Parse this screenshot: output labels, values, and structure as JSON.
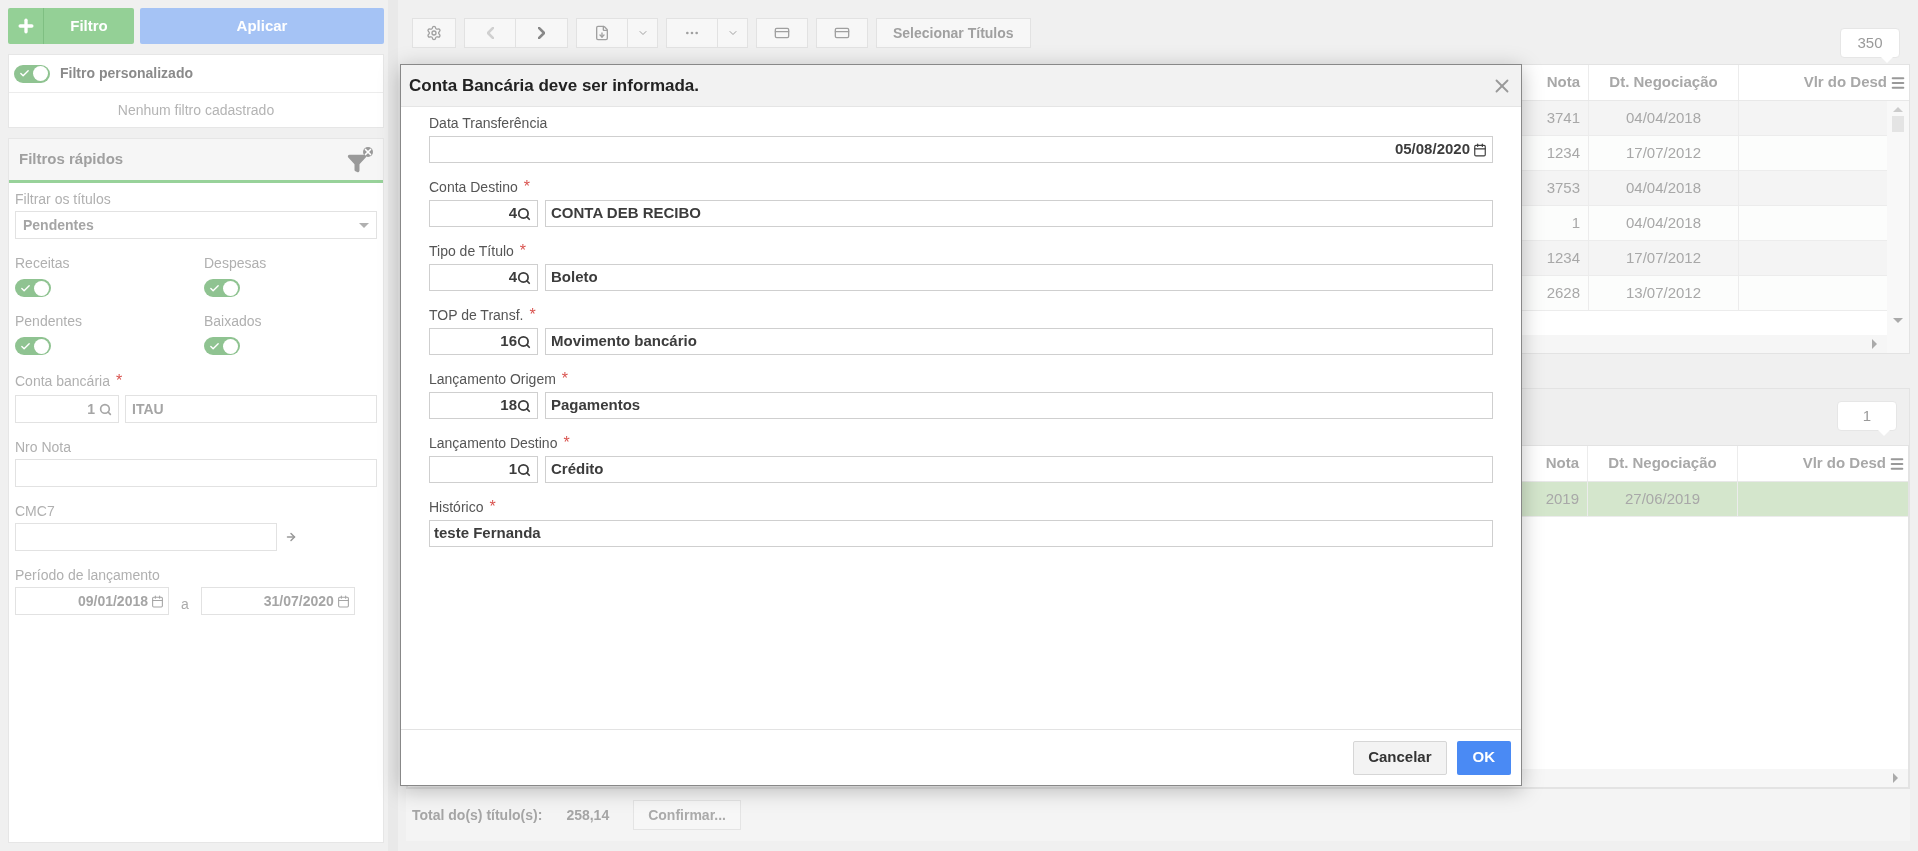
{
  "filter_bar": {
    "add_button": "Filtro",
    "apply_button": "Aplicar"
  },
  "custom_filter": {
    "label": "Filtro personalizado",
    "on": true,
    "empty_message": "Nenhum filtro cadastrado"
  },
  "quick_filters": {
    "title": "Filtros rápidos",
    "items": [
      {
        "kind": "select",
        "label": "Filtrar os títulos",
        "value": "Pendentes"
      },
      {
        "kind": "toggles",
        "toggles": [
          {
            "label": "Receitas",
            "on": true
          },
          {
            "label": "Despesas",
            "on": true
          }
        ]
      },
      {
        "kind": "toggles",
        "toggles": [
          {
            "label": "Pendentes",
            "on": true
          },
          {
            "label": "Baixados",
            "on": true
          }
        ]
      },
      {
        "kind": "lookup",
        "label": "Conta bancária",
        "required_mark": "*",
        "code": "1",
        "name": "ITAU"
      },
      {
        "kind": "text",
        "label": "Nro Nota"
      },
      {
        "kind": "text_action",
        "label": "CMC7"
      },
      {
        "kind": "date_range",
        "label": "Período de lançamento",
        "from": "09/01/2018",
        "separator": "a",
        "to": "31/07/2020"
      }
    ]
  },
  "toolbar": {
    "select_button": "Selecionar Títulos"
  },
  "grids": [
    {
      "count": "350",
      "columns": [
        "Nota",
        "Dt. Negociação",
        "Vlr do Desd"
      ],
      "rows": [
        {
          "cells": [
            "3741",
            "04/04/2018"
          ],
          "selected": false
        },
        {
          "cells": [
            "1234",
            "17/07/2012"
          ],
          "selected": false
        },
        {
          "cells": [
            "3753",
            "04/04/2018"
          ],
          "selected": false
        },
        {
          "cells": [
            "1",
            "04/04/2018"
          ],
          "selected": false
        },
        {
          "cells": [
            "1234",
            "17/07/2012"
          ],
          "selected": false
        },
        {
          "cells": [
            "2628",
            "13/07/2012"
          ],
          "selected": false
        }
      ]
    },
    {
      "count": "1",
      "columns": [
        "Nota",
        "Dt. Negociação",
        "Vlr do Desd"
      ],
      "rows": [
        {
          "cells": [
            "2019",
            "27/06/2019"
          ],
          "selected": true
        }
      ]
    }
  ],
  "footer": {
    "total_label": "Total do(s) título(s):",
    "total_value": "258,14",
    "confirm_button": "Confirmar..."
  },
  "dialog": {
    "title": "Conta Bancária deve ser informada.",
    "fields": [
      {
        "kind": "date",
        "label": "Data Transferência",
        "value": "05/08/2020"
      },
      {
        "kind": "lookup",
        "label": "Conta Destino",
        "required_mark": "*",
        "code": "4",
        "name": "CONTA DEB RECIBO"
      },
      {
        "kind": "lookup",
        "label": "Tipo de Título",
        "required_mark": "*",
        "code": "4",
        "name": "Boleto"
      },
      {
        "kind": "lookup",
        "label": "TOP de Transf.",
        "required_mark": "*",
        "code": "16",
        "name": "Movimento bancário"
      },
      {
        "kind": "lookup",
        "label": "Lançamento Origem",
        "required_mark": "*",
        "code": "18",
        "name": "Pagamentos"
      },
      {
        "kind": "lookup",
        "label": "Lançamento Destino",
        "required_mark": "*",
        "code": "1",
        "name": "Crédito"
      },
      {
        "kind": "text",
        "label": "Histórico",
        "required_mark": "*",
        "value": "teste Fernanda"
      }
    ],
    "buttons": [
      {
        "label": "Cancelar",
        "kind": "secondary"
      },
      {
        "label": "OK",
        "kind": "primary"
      }
    ]
  }
}
